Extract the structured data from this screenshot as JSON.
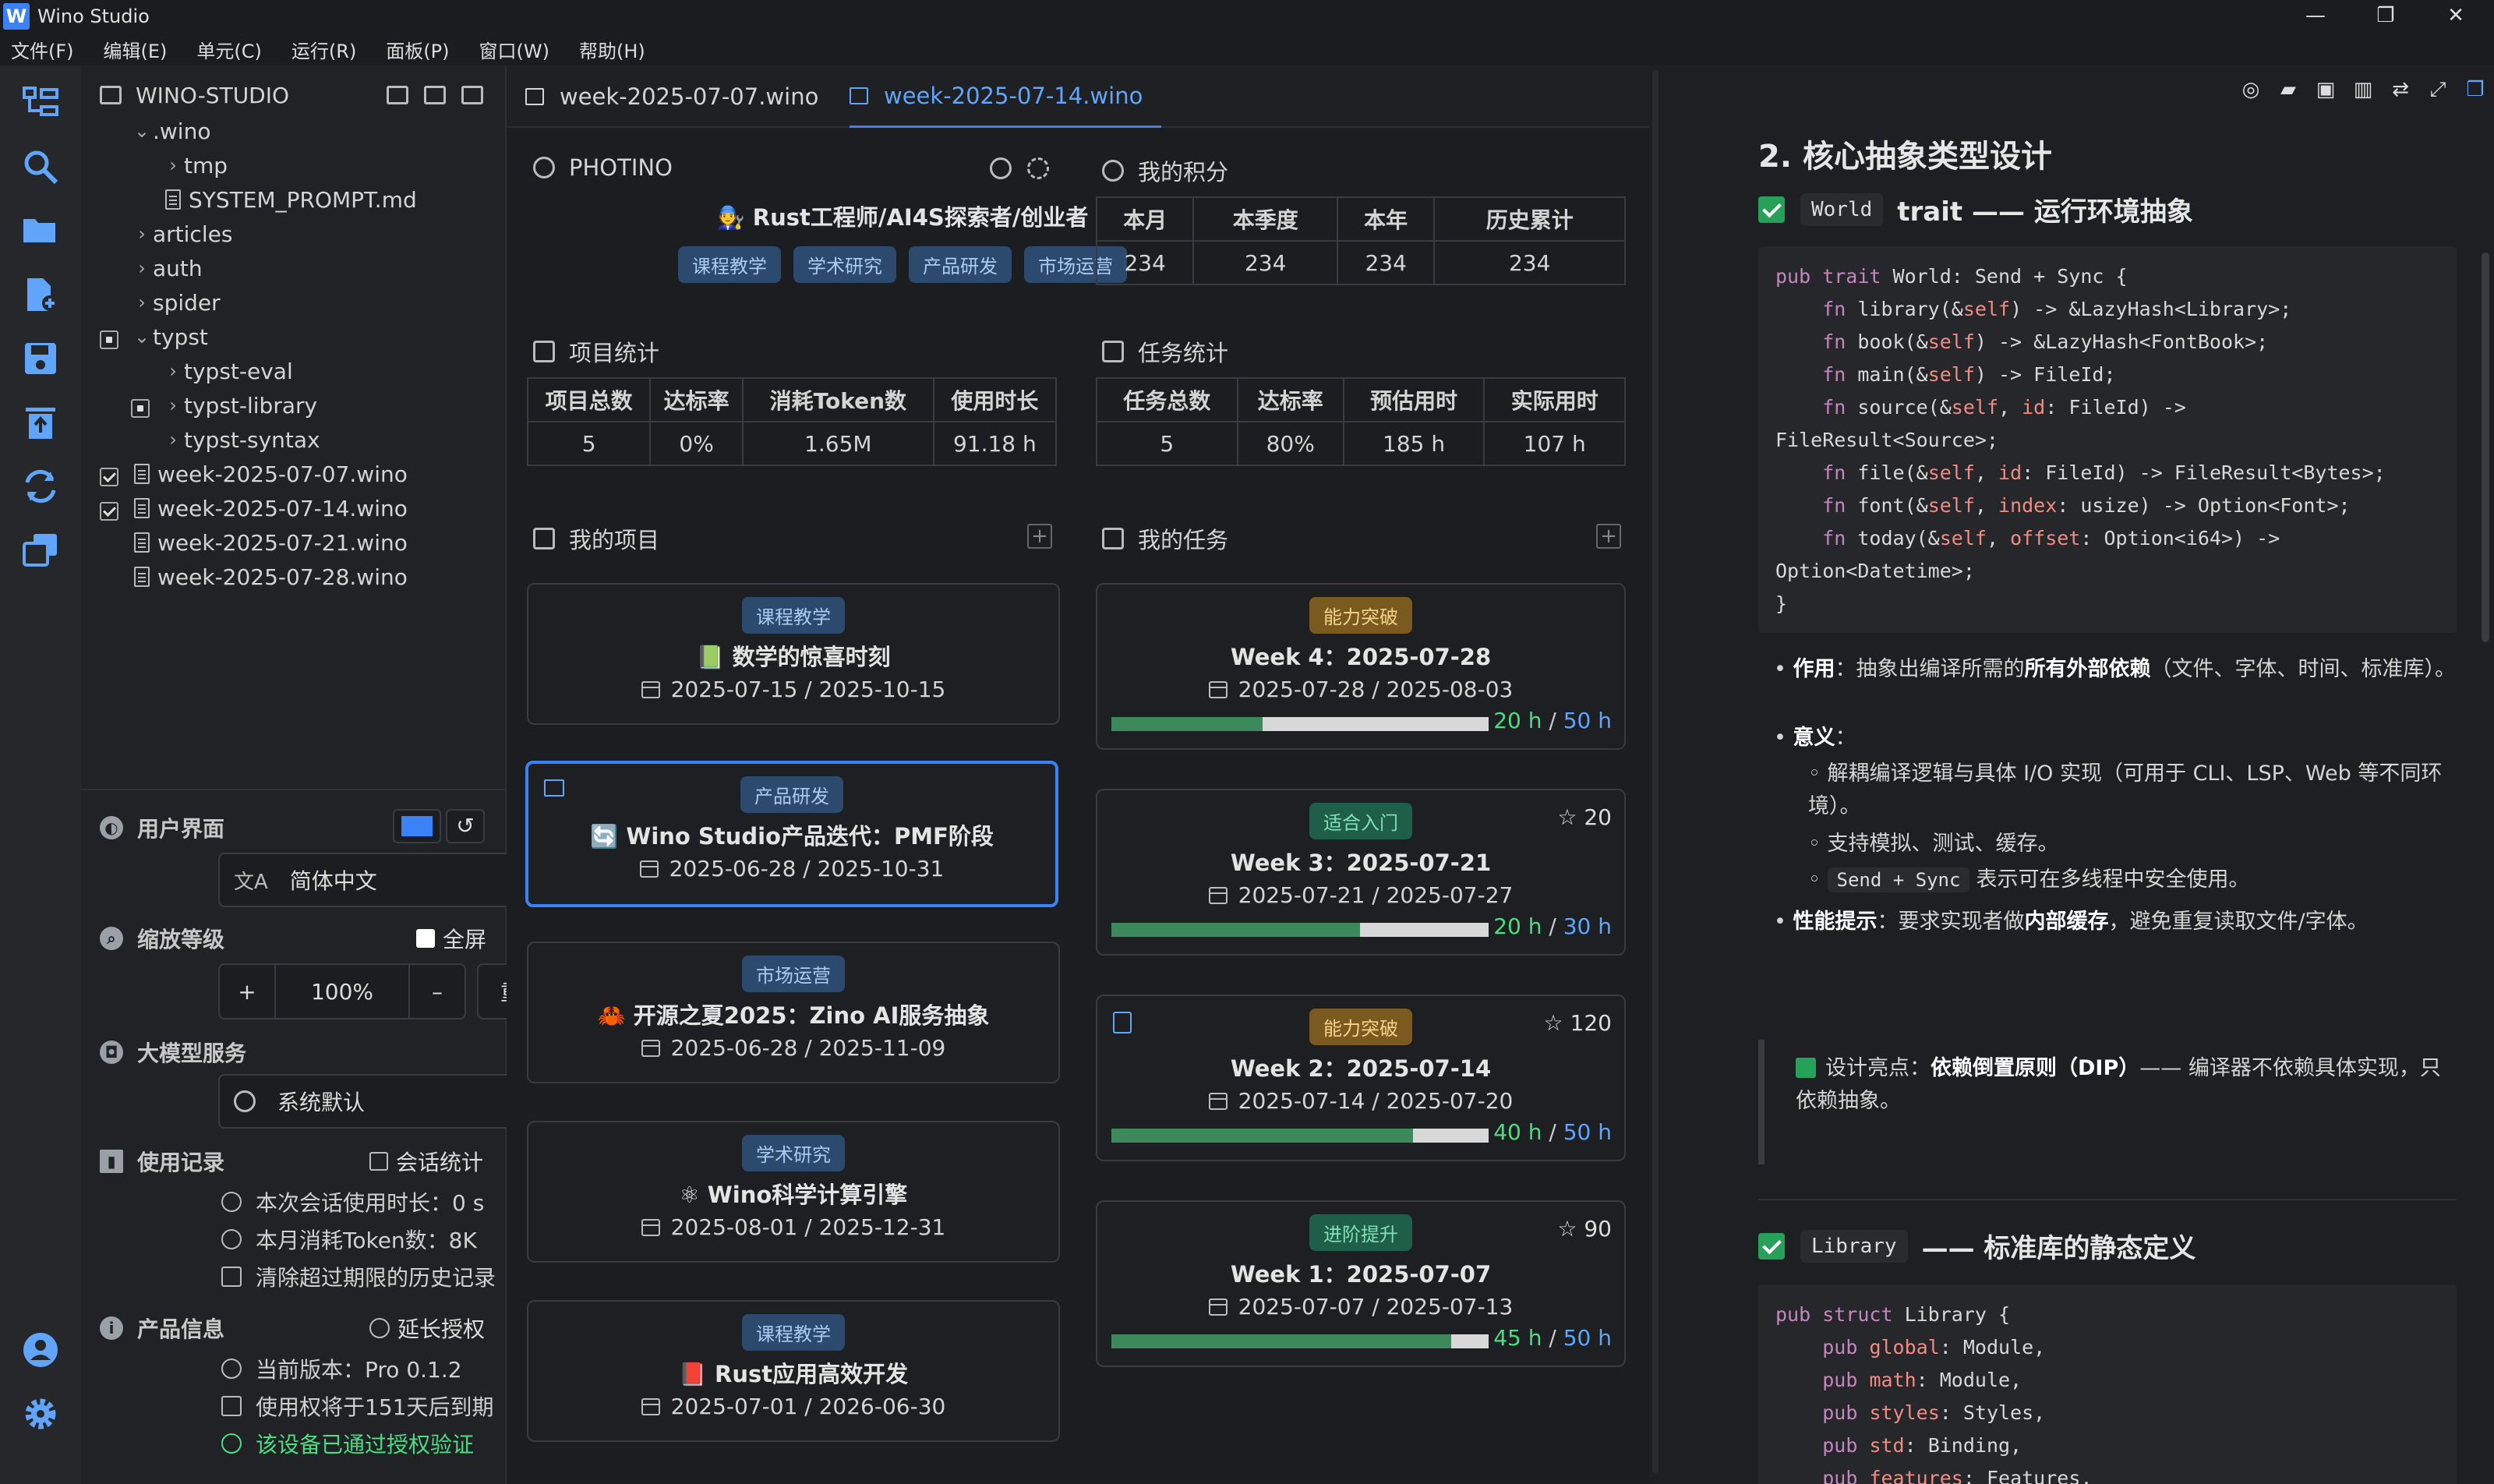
{
  "window": {
    "title": "Wino Studio",
    "logo": "W"
  },
  "menu": [
    "文件(F)",
    "编辑(E)",
    "单元(C)",
    "运行(R)",
    "面板(P)",
    "窗口(W)",
    "帮助(H)"
  ],
  "explorer": {
    "root": "WINO-STUDIO",
    "items": [
      ".wino",
      "tmp",
      "SYSTEM_PROMPT.md",
      "articles",
      "auth",
      "spider",
      "typst",
      "typst-eval",
      "typst-library",
      "typst-syntax",
      "week-2025-07-07.wino",
      "week-2025-07-14.wino",
      "week-2025-07-21.wino",
      "week-2025-07-28.wino"
    ]
  },
  "ui_section": {
    "title": "用户界面",
    "language": "简体中文",
    "accent": "#3b82f6"
  },
  "zoom": {
    "title": "缩放等级",
    "fullscreen": "全屏",
    "plus": "+",
    "value": "100%",
    "minus": "–",
    "reset": "重置"
  },
  "llm": {
    "title": "大模型服务",
    "value": "系统默认"
  },
  "usage": {
    "title": "使用记录",
    "stats_link": "会话统计",
    "rows": [
      "本次会话使用时长：0 s",
      "本月消耗Token数：8K",
      "清除超过期限的历史记录"
    ]
  },
  "product": {
    "title": "产品信息",
    "extend": "延长授权",
    "rows": [
      "当前版本：Pro 0.1.2",
      "使用权将于151天后到期"
    ],
    "verified": "该设备已通过授权验证"
  },
  "tabs": [
    "week-2025-07-07.wino",
    "week-2025-07-14.wino"
  ],
  "profile": {
    "name": "PHOTINO",
    "role": "🧑‍🔧 Rust工程师/AI4S探索者/创业者",
    "tags": [
      "课程教学",
      "学术研究",
      "产品研发",
      "市场运营"
    ]
  },
  "points": {
    "title": "我的积分",
    "headers": [
      "本月",
      "本季度",
      "本年",
      "历史累计"
    ],
    "values": [
      "234",
      "234",
      "234",
      "234"
    ]
  },
  "project_stats": {
    "title": "项目统计",
    "headers": [
      "项目总数",
      "达标率",
      "消耗Token数",
      "使用时长"
    ],
    "values": [
      "5",
      "0%",
      "1.65M",
      "91.18 h"
    ]
  },
  "task_stats": {
    "title": "任务统计",
    "headers": [
      "任务总数",
      "达标率",
      "预估用时",
      "实际用时"
    ],
    "values": [
      "5",
      "80%",
      "185 h",
      "107 h"
    ]
  },
  "projects": {
    "title": "我的项目",
    "add": "+",
    "items": [
      {
        "tag": "课程教学",
        "title": "📗 数学的惊喜时刻",
        "date": "2025-07-15 / 2025-10-15"
      },
      {
        "tag": "产品研发",
        "title": "🔄 Wino Studio产品迭代：PMF阶段",
        "date": "2025-06-28 / 2025-10-31"
      },
      {
        "tag": "市场运营",
        "title": "🦀 开源之夏2025：Zino AI服务抽象",
        "date": "2025-06-28 / 2025-11-09"
      },
      {
        "tag": "学术研究",
        "title": "⚛ Wino科学计算引擎",
        "date": "2025-08-01 / 2025-12-31"
      },
      {
        "tag": "课程教学",
        "title": "📕 Rust应用高效开发",
        "date": "2025-07-01 / 2026-06-30"
      }
    ]
  },
  "tasks": {
    "title": "我的任务",
    "add": "+",
    "items": [
      {
        "tag": "能力突破",
        "title": "Week 4：2025-07-28",
        "date": "2025-07-28 / 2025-08-03",
        "actual": "20 h",
        "sep": " / ",
        "estimate": "50 h",
        "progress": 0.4,
        "stars": ""
      },
      {
        "tag": "适合入门",
        "title": "Week 3：2025-07-21",
        "date": "2025-07-21 / 2025-07-27",
        "actual": "20 h",
        "sep": " / ",
        "estimate": "30 h",
        "progress": 0.66,
        "stars": "☆ 20"
      },
      {
        "tag": "能力突破",
        "title": "Week 2：2025-07-14",
        "date": "2025-07-14 / 2025-07-20",
        "actual": "40 h",
        "sep": " / ",
        "estimate": "50 h",
        "progress": 0.8,
        "stars": "☆ 120"
      },
      {
        "tag": "进阶提升",
        "title": "Week 1：2025-07-07",
        "date": "2025-07-07 / 2025-07-13",
        "actual": "45 h",
        "sep": " / ",
        "estimate": "50 h",
        "progress": 0.9,
        "stars": "☆ 90"
      }
    ]
  },
  "preview": {
    "h2": "2. 核心抽象类型设计",
    "s1": {
      "code": "World",
      "title": "trait —— 运行环境抽象"
    },
    "b1_label": "作用",
    "b1_pre": "：抽象出编译所需的",
    "b1_bold": "所有外部依赖",
    "b1_post": "（文件、字体、时间、标准库）。",
    "b2_label": "意义",
    "b2_post": "：",
    "sub1": "解耦编译逻辑与具体 I/O 实现（可用于 CLI、LSP、Web 等不同环境）。",
    "sub2": "支持模拟、测试、缓存。",
    "sub3_code": "Send + Sync",
    "sub3_text": "表示可在多线程中安全使用。",
    "b3_label": "性能提示",
    "b3_pre": "：要求实现者做",
    "b3_bold": "内部缓存",
    "b3_post": "，避免重复读取文件/字体。",
    "quote_pre": "设计亮点：",
    "quote_bold": "依赖倒置原则（DIP）",
    "quote_post": "—— 编译器不依赖具体实现，只依赖抽象。",
    "s2": {
      "code": "Library",
      "title": "—— 标准库的静态定义"
    }
  }
}
